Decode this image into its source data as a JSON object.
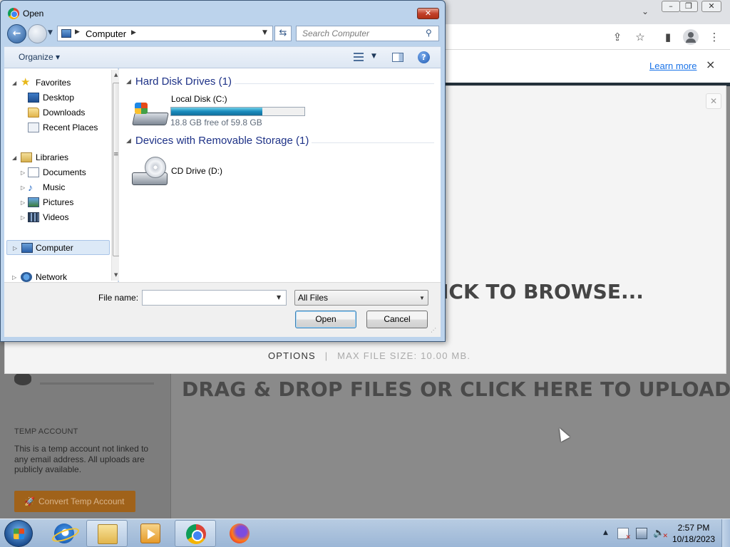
{
  "browser": {
    "info_bar": {
      "learn_more": "Learn more",
      "close_icon": "×"
    }
  },
  "page": {
    "drag_drop_text": "DRAG & DROP FILES OR CLICK HERE TO UPLOAD",
    "sidebar": {
      "temp_account_title": "TEMP ACCOUNT",
      "temp_account_text": "This is a temp account not linked to any email address. All uploads are publicly available.",
      "convert_button": "Convert Temp Account"
    },
    "modal": {
      "browse_text": "ICK TO BROWSE...",
      "options_label": "OPTIONS",
      "separator": "|",
      "max_file_size": "MAX FILE SIZE: 10.00 MB."
    }
  },
  "dialog": {
    "title": "Open",
    "address": {
      "location": "Computer"
    },
    "search": {
      "placeholder": "Search Computer"
    },
    "toolbar": {
      "organize_label": "Organize ▾"
    },
    "nav_pane": {
      "favorites": {
        "label": "Favorites",
        "items": [
          "Desktop",
          "Downloads",
          "Recent Places"
        ]
      },
      "libraries": {
        "label": "Libraries",
        "items": [
          "Documents",
          "Music",
          "Pictures",
          "Videos"
        ]
      },
      "computer": "Computer",
      "network": "Network"
    },
    "groups": [
      {
        "header": "Hard Disk Drives (1)",
        "items": [
          {
            "name": "Local Disk (C:)",
            "free_text": "18.8 GB free of 59.8 GB",
            "used_fraction": 0.686
          }
        ]
      },
      {
        "header": "Devices with Removable Storage (1)",
        "items": [
          {
            "name": "CD Drive (D:)"
          }
        ]
      }
    ],
    "file_name_label": "File name:",
    "file_name_value": "",
    "file_type": "All Files",
    "open_button": "Open",
    "cancel_button": "Cancel"
  },
  "taskbar": {
    "clock_time": "2:57 PM",
    "clock_date": "10/18/2023"
  },
  "colors": {
    "dialog_frame": "#bcd3ec",
    "group_header": "#1e3287",
    "disk_bar_fill": "#1a8bbd",
    "convert_button": "#a0621a"
  }
}
